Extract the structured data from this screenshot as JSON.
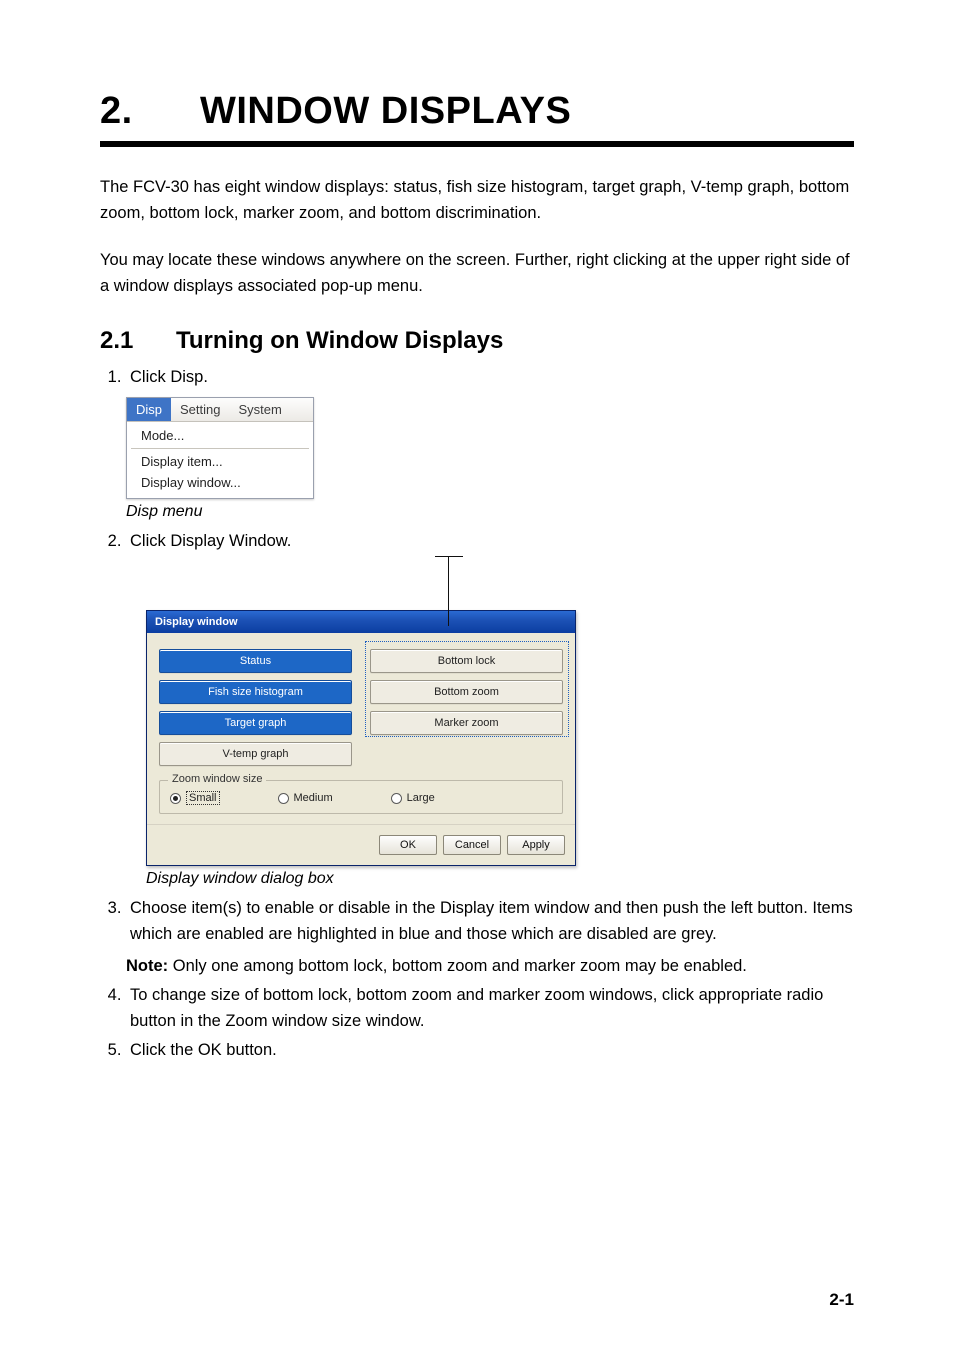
{
  "chapter": {
    "number": "2.",
    "title": "WINDOW DISPLAYS"
  },
  "intro": {
    "p1": "The FCV-30 has eight window displays: status, fish size histogram, target graph, V-temp graph, bottom zoom, bottom lock, marker zoom, and bottom discrimination.",
    "p2": "You may locate these windows anywhere on the screen. Further, right clicking at the upper right side of a window displays associated pop-up menu."
  },
  "section": {
    "number": "2.1",
    "title": "Turning on Window Displays"
  },
  "steps": {
    "s1": "Click Disp.",
    "s2": "Click Display Window.",
    "s3": "Choose item(s) to enable or disable in the Display item window and then push the left button. Items which are enabled are highlighted in blue and those which are disabled are grey.",
    "s4": "To change size of bottom lock, bottom zoom and marker zoom windows, click appropriate radio button in the Zoom window size window.",
    "s5": "Click the OK button."
  },
  "note": {
    "label": "Note:",
    "text": " Only one among bottom lock, bottom zoom and marker zoom may be enabled."
  },
  "fig1": {
    "menubar": {
      "disp": "Disp",
      "setting": "Setting",
      "system": "System"
    },
    "items": {
      "mode": "Mode...",
      "display_item": "Display item...",
      "display_window": "Display window..."
    },
    "caption": "Disp menu"
  },
  "fig2": {
    "title": "Display window",
    "opts": {
      "status": "Status",
      "fish": "Fish size histogram",
      "target": "Target graph",
      "vtemp": "V-temp graph",
      "block": "Bottom lock",
      "bzoom": "Bottom zoom",
      "mzoom": "Marker zoom"
    },
    "group": {
      "legend": "Zoom window size",
      "small": "Small",
      "medium": "Medium",
      "large": "Large"
    },
    "buttons": {
      "ok": "OK",
      "cancel": "Cancel",
      "apply": "Apply"
    },
    "caption": "Display window dialog box"
  },
  "page_number": "2-1"
}
